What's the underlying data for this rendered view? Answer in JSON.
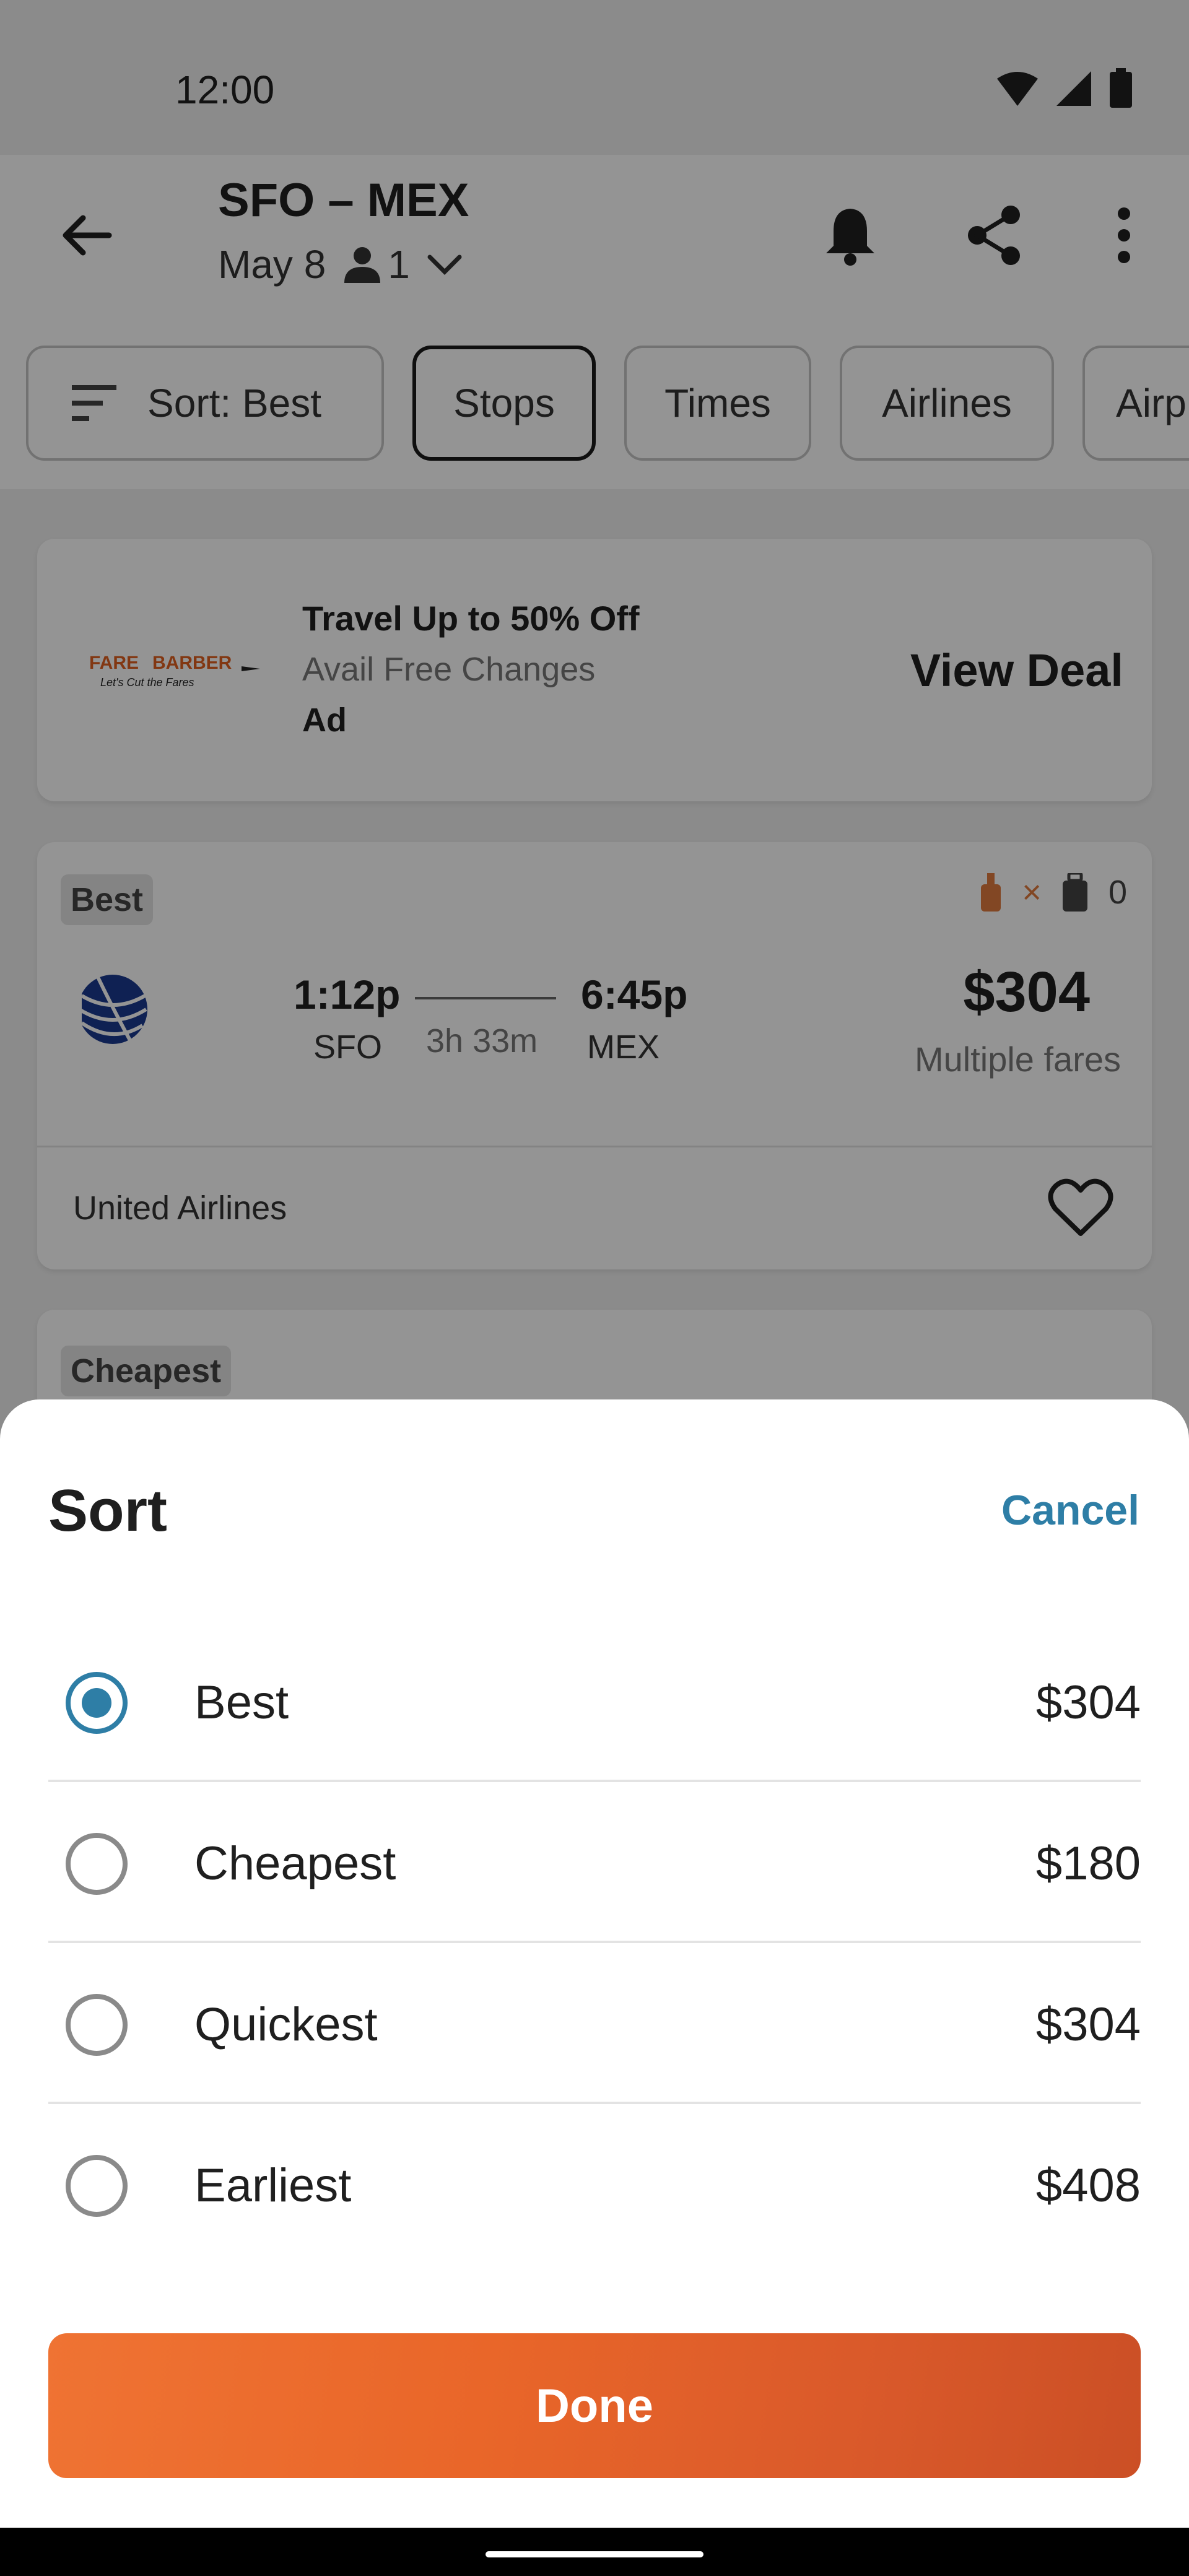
{
  "status_bar": {
    "time": "12:00"
  },
  "header": {
    "route": "SFO – MEX",
    "date": "May 8",
    "passengers": "1"
  },
  "filters": {
    "sort_label": "Sort: Best",
    "chips": [
      "Stops",
      "Times",
      "Airlines",
      "Airp"
    ]
  },
  "ad": {
    "brand": "FARE BARBER",
    "brand_tagline": "Let's Cut the Fares",
    "title": "Travel Up to 50% Off",
    "subtitle": "Avail Free Changes",
    "tag": "Ad",
    "cta": "View Deal"
  },
  "flights": [
    {
      "badge": "Best",
      "carry_on_count": "×",
      "checked_count": "0",
      "depart_time": "1:12p",
      "depart_code": "SFO",
      "duration": "3h 33m",
      "arrive_time": "6:45p",
      "arrive_code": "MEX",
      "price": "$304",
      "fare_note": "Multiple fares",
      "airline": "United Airlines"
    },
    {
      "badge": "Cheapest"
    }
  ],
  "sort_sheet": {
    "title": "Sort",
    "cancel": "Cancel",
    "options": [
      {
        "label": "Best",
        "price": "$304",
        "selected": true
      },
      {
        "label": "Cheapest",
        "price": "$180",
        "selected": false
      },
      {
        "label": "Quickest",
        "price": "$304",
        "selected": false
      },
      {
        "label": "Earliest",
        "price": "$408",
        "selected": false
      }
    ],
    "done": "Done"
  },
  "colors": {
    "accent_blue": "#2e7ea6",
    "done_orange": "#e96629"
  }
}
